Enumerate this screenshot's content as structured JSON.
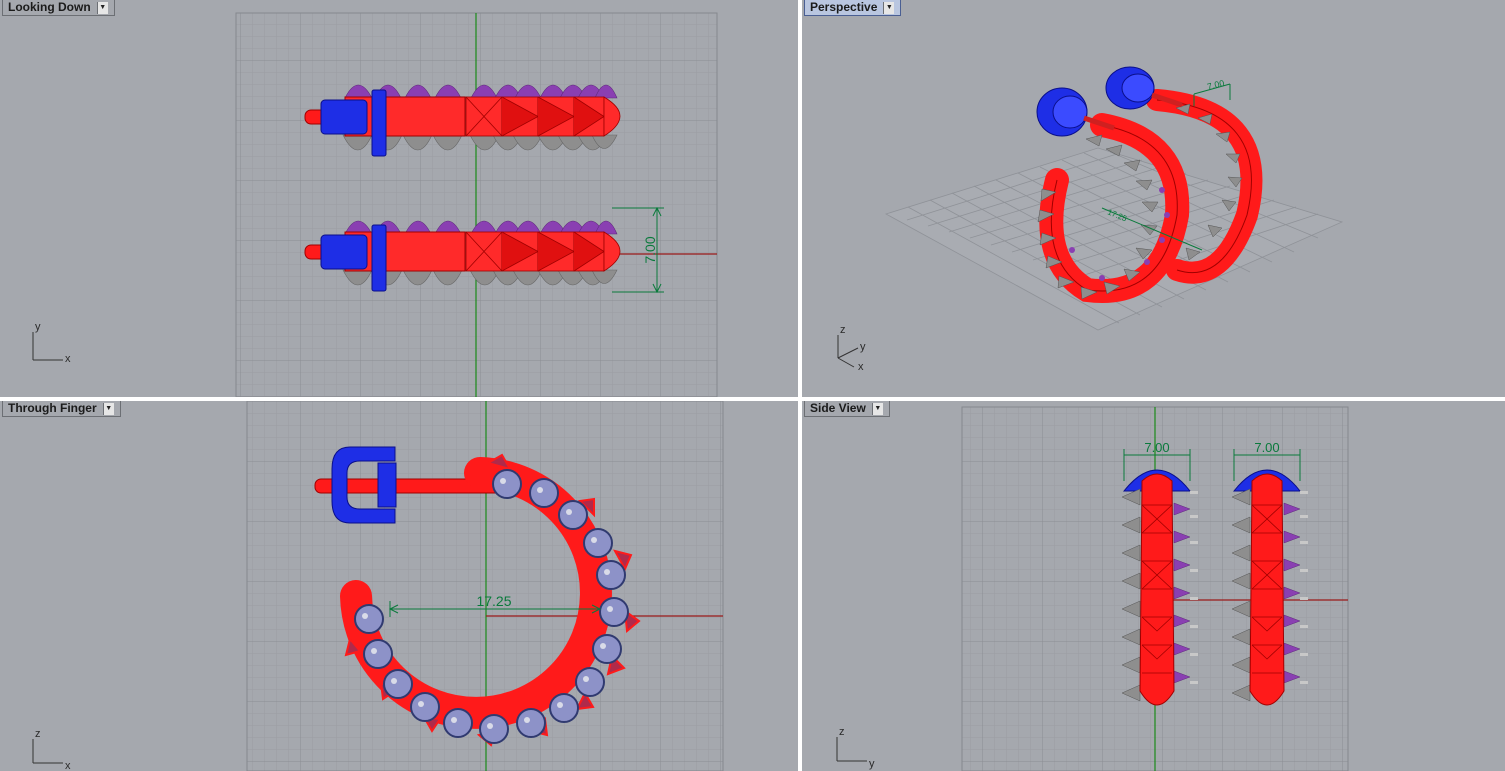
{
  "viewports": {
    "top_left": {
      "title": "Looking Down",
      "active": false,
      "axes": [
        "y",
        "x"
      ],
      "dimension": "7.00"
    },
    "top_right": {
      "title": "Perspective",
      "active": true,
      "axes": [
        "z",
        "y",
        "x"
      ],
      "dimensions": [
        "7.00",
        "17.25"
      ]
    },
    "bottom_left": {
      "title": "Through Finger",
      "active": false,
      "axes": [
        "z",
        "x"
      ],
      "dimension": "17.25"
    },
    "bottom_right": {
      "title": "Side View",
      "active": false,
      "axes": [
        "z",
        "y"
      ],
      "dimensions": [
        "7.00",
        "7.00"
      ]
    }
  },
  "colors": {
    "background": "#a5a8ae",
    "grid": "#989ba1",
    "axis_x": "#9a1a1a",
    "axis_y": "#1a8a1a",
    "earring_body": "#ff1a1a",
    "earring_back": "#1e2ee6",
    "spike": "#8e8e8e",
    "gem": "#8a3fb2",
    "dimension": "#0a7a3c"
  }
}
